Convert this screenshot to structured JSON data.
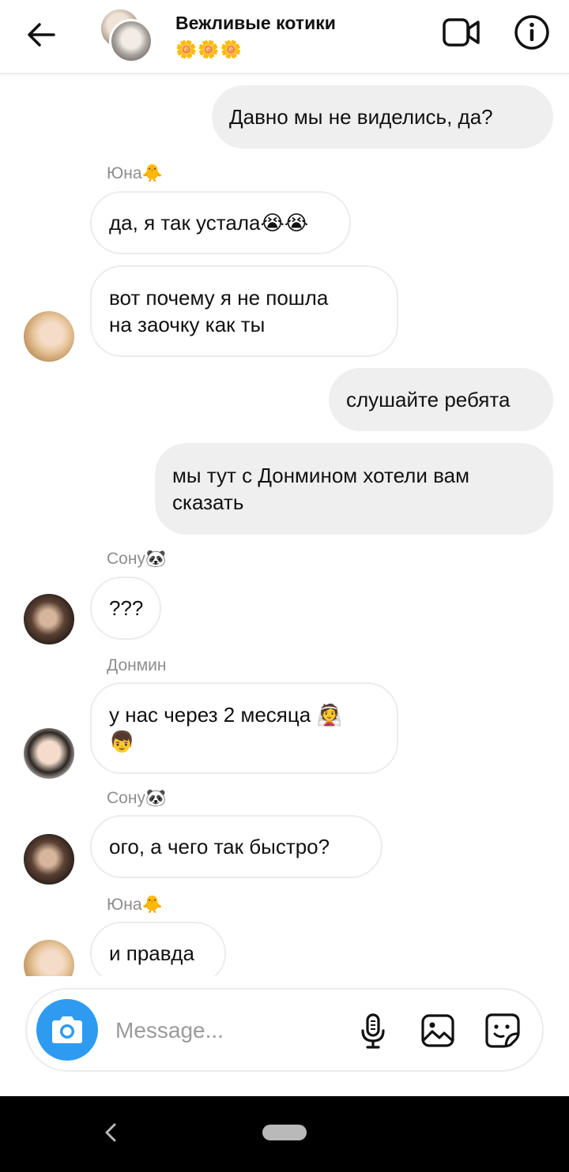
{
  "header": {
    "title": "Вежливые котики",
    "subtitle": "🌼🌼🌼",
    "icons": [
      "back-arrow-icon",
      "video-camera-icon",
      "info-icon"
    ]
  },
  "messages": [
    {
      "side": "out",
      "text": "Давно мы не виделись, да?"
    },
    {
      "side": "in",
      "sender": "Юна🐥",
      "text": "да, я так устала😭😭"
    },
    {
      "side": "in",
      "text": "вот почему я не пошла\nна заочку как ты"
    },
    {
      "side": "out",
      "text": "слушайте ребята"
    },
    {
      "side": "out",
      "text": "мы тут с Донмином хотели вам\nсказать"
    },
    {
      "side": "in",
      "sender": "Сону🐼",
      "text": "???"
    },
    {
      "side": "in",
      "sender": "Донмин",
      "text": "у нас через 2 месяца 👰\n👦"
    },
    {
      "side": "in",
      "sender": "Сону🐼",
      "text": "ого, а чего так быстро?"
    },
    {
      "side": "in",
      "sender": "Юна🐥",
      "text": "и правда"
    }
  ],
  "composer": {
    "placeholder": "Message...",
    "icons": [
      "camera-icon",
      "microphone-icon",
      "gallery-icon",
      "sticker-icon"
    ],
    "accent_color": "#2f9bf0"
  },
  "navbar": {
    "icons": [
      "nav-back-icon",
      "home-pill"
    ]
  }
}
